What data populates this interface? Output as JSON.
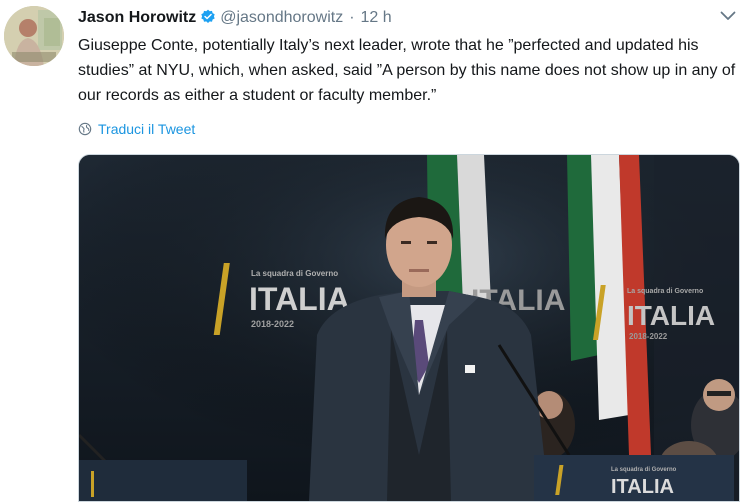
{
  "tweet": {
    "author_name": "Jason Horowitz",
    "handle": "@jasondhorowitz",
    "separator": "·",
    "time": "12 h",
    "text": "Giuseppe Conte, potentially Italy’s next leader, wrote that he ”perfected and updated his studies” at NYU, which, when asked, said ”A person by this name does not show up in any of our records as either a student or faculty member.”",
    "translate_label": "Traduci il Tweet"
  },
  "media": {
    "banner_small": "La squadra di Governo",
    "banner_main": "ITALIA",
    "banner_years": "2018-2022"
  },
  "icons": {
    "verified": "verified-badge-icon",
    "menu": "chevron-down-icon",
    "translate": "globe-icon"
  },
  "colors": {
    "link": "#1b95e0",
    "verified": "#1da1f2",
    "secondary_text": "#657786"
  }
}
